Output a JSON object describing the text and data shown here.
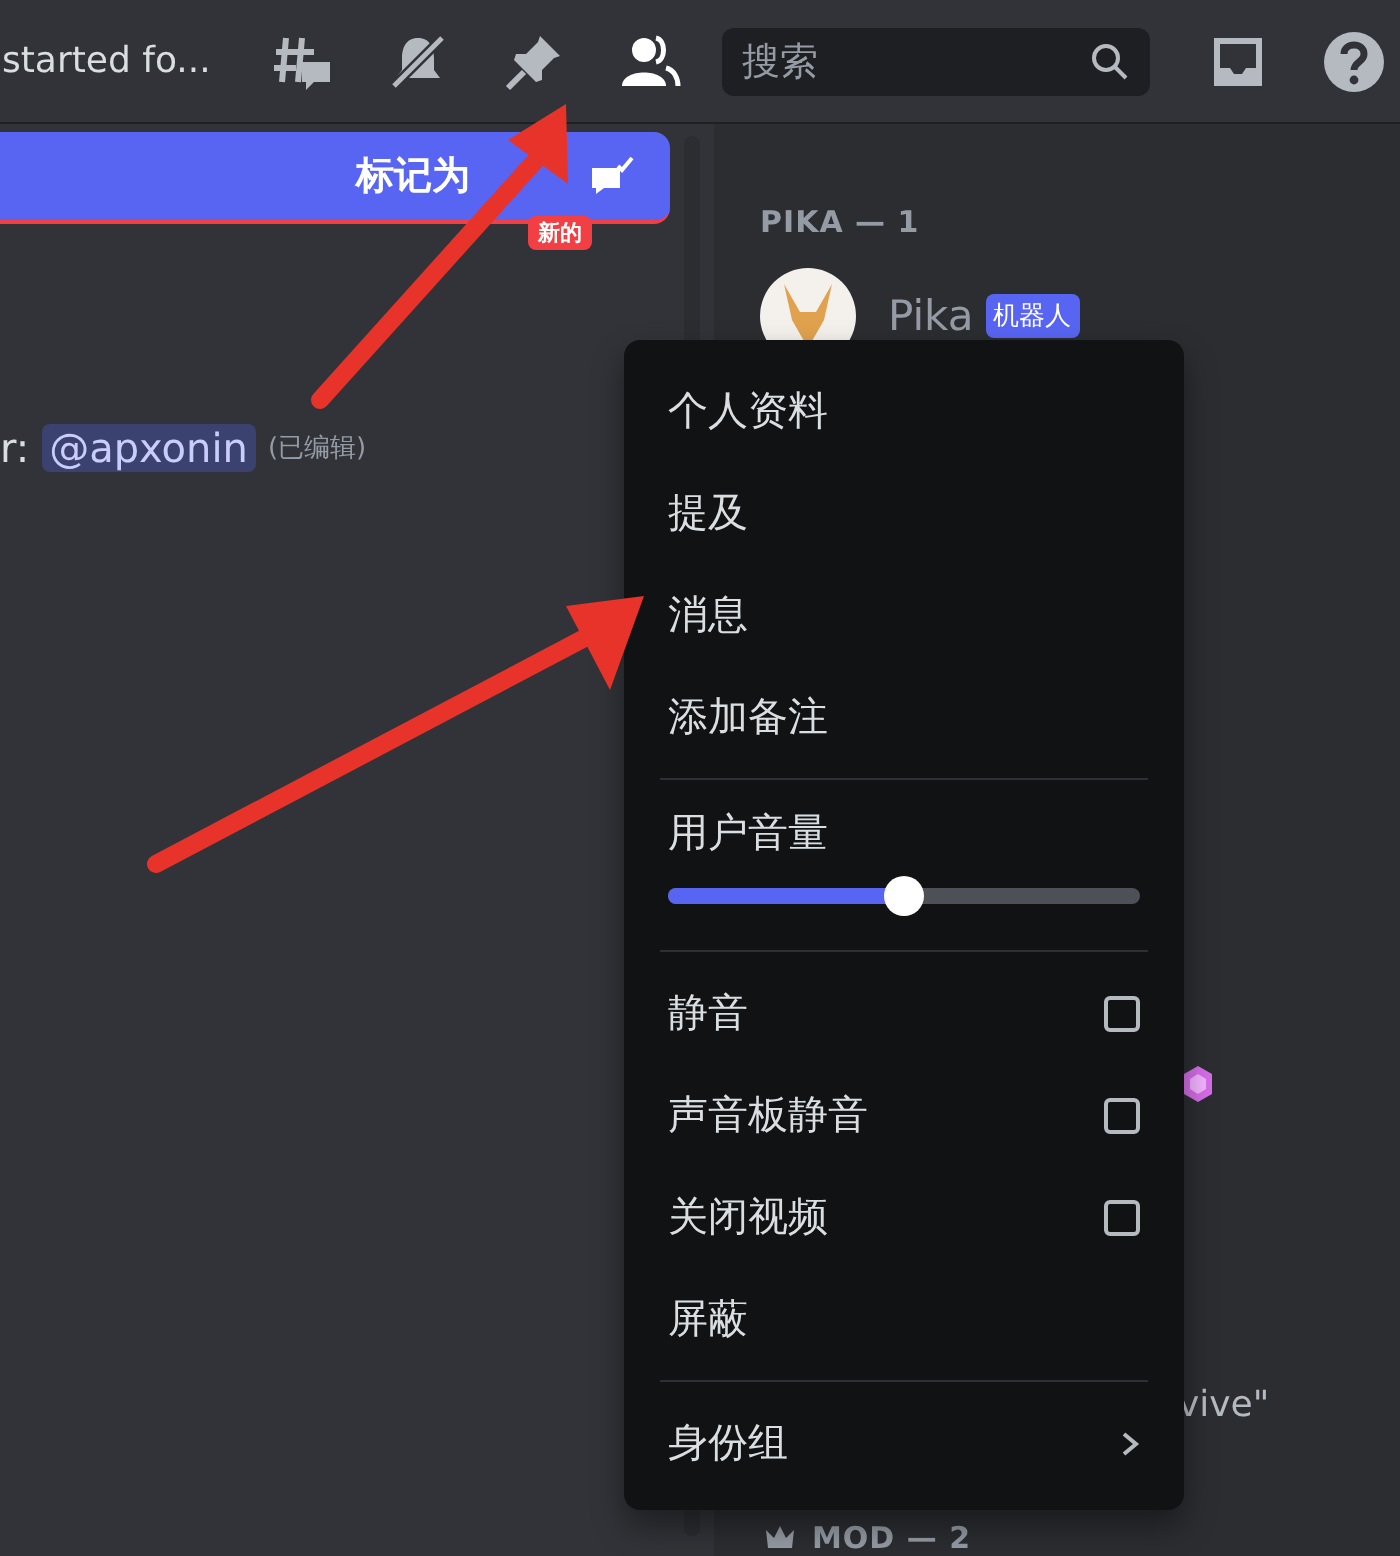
{
  "header": {
    "channel_title": "started fo...",
    "search": {
      "placeholder": "搜索"
    }
  },
  "banner": {
    "label": "标记为",
    "badge": "新的"
  },
  "message": {
    "prefix": "r:",
    "mention": "@apxonin",
    "edited": "(已编辑)"
  },
  "members": {
    "group_title": "PIKA — 1",
    "member": {
      "name": "Pika",
      "tag": "机器人"
    },
    "partial_text": "vive\"",
    "next_group_title": "MOD — 2"
  },
  "context_menu": {
    "items": [
      {
        "kind": "action",
        "label": "个人资料",
        "separated": false
      },
      {
        "kind": "action",
        "label": "提及",
        "separated": false
      },
      {
        "kind": "action",
        "label": "消息",
        "separated": false
      },
      {
        "kind": "action",
        "label": "添加备注",
        "separated": false
      },
      {
        "kind": "slider",
        "label": "用户音量",
        "separated": true,
        "level": 0.5
      },
      {
        "kind": "checkbox",
        "label": "静音",
        "separated": true,
        "checked": false
      },
      {
        "kind": "checkbox",
        "label": "声音板静音",
        "separated": false,
        "checked": false
      },
      {
        "kind": "checkbox",
        "label": "关闭视频",
        "separated": false,
        "checked": false
      },
      {
        "kind": "action",
        "label": "屏蔽",
        "separated": false
      },
      {
        "kind": "submenu",
        "label": "身份组",
        "separated": true
      }
    ]
  }
}
